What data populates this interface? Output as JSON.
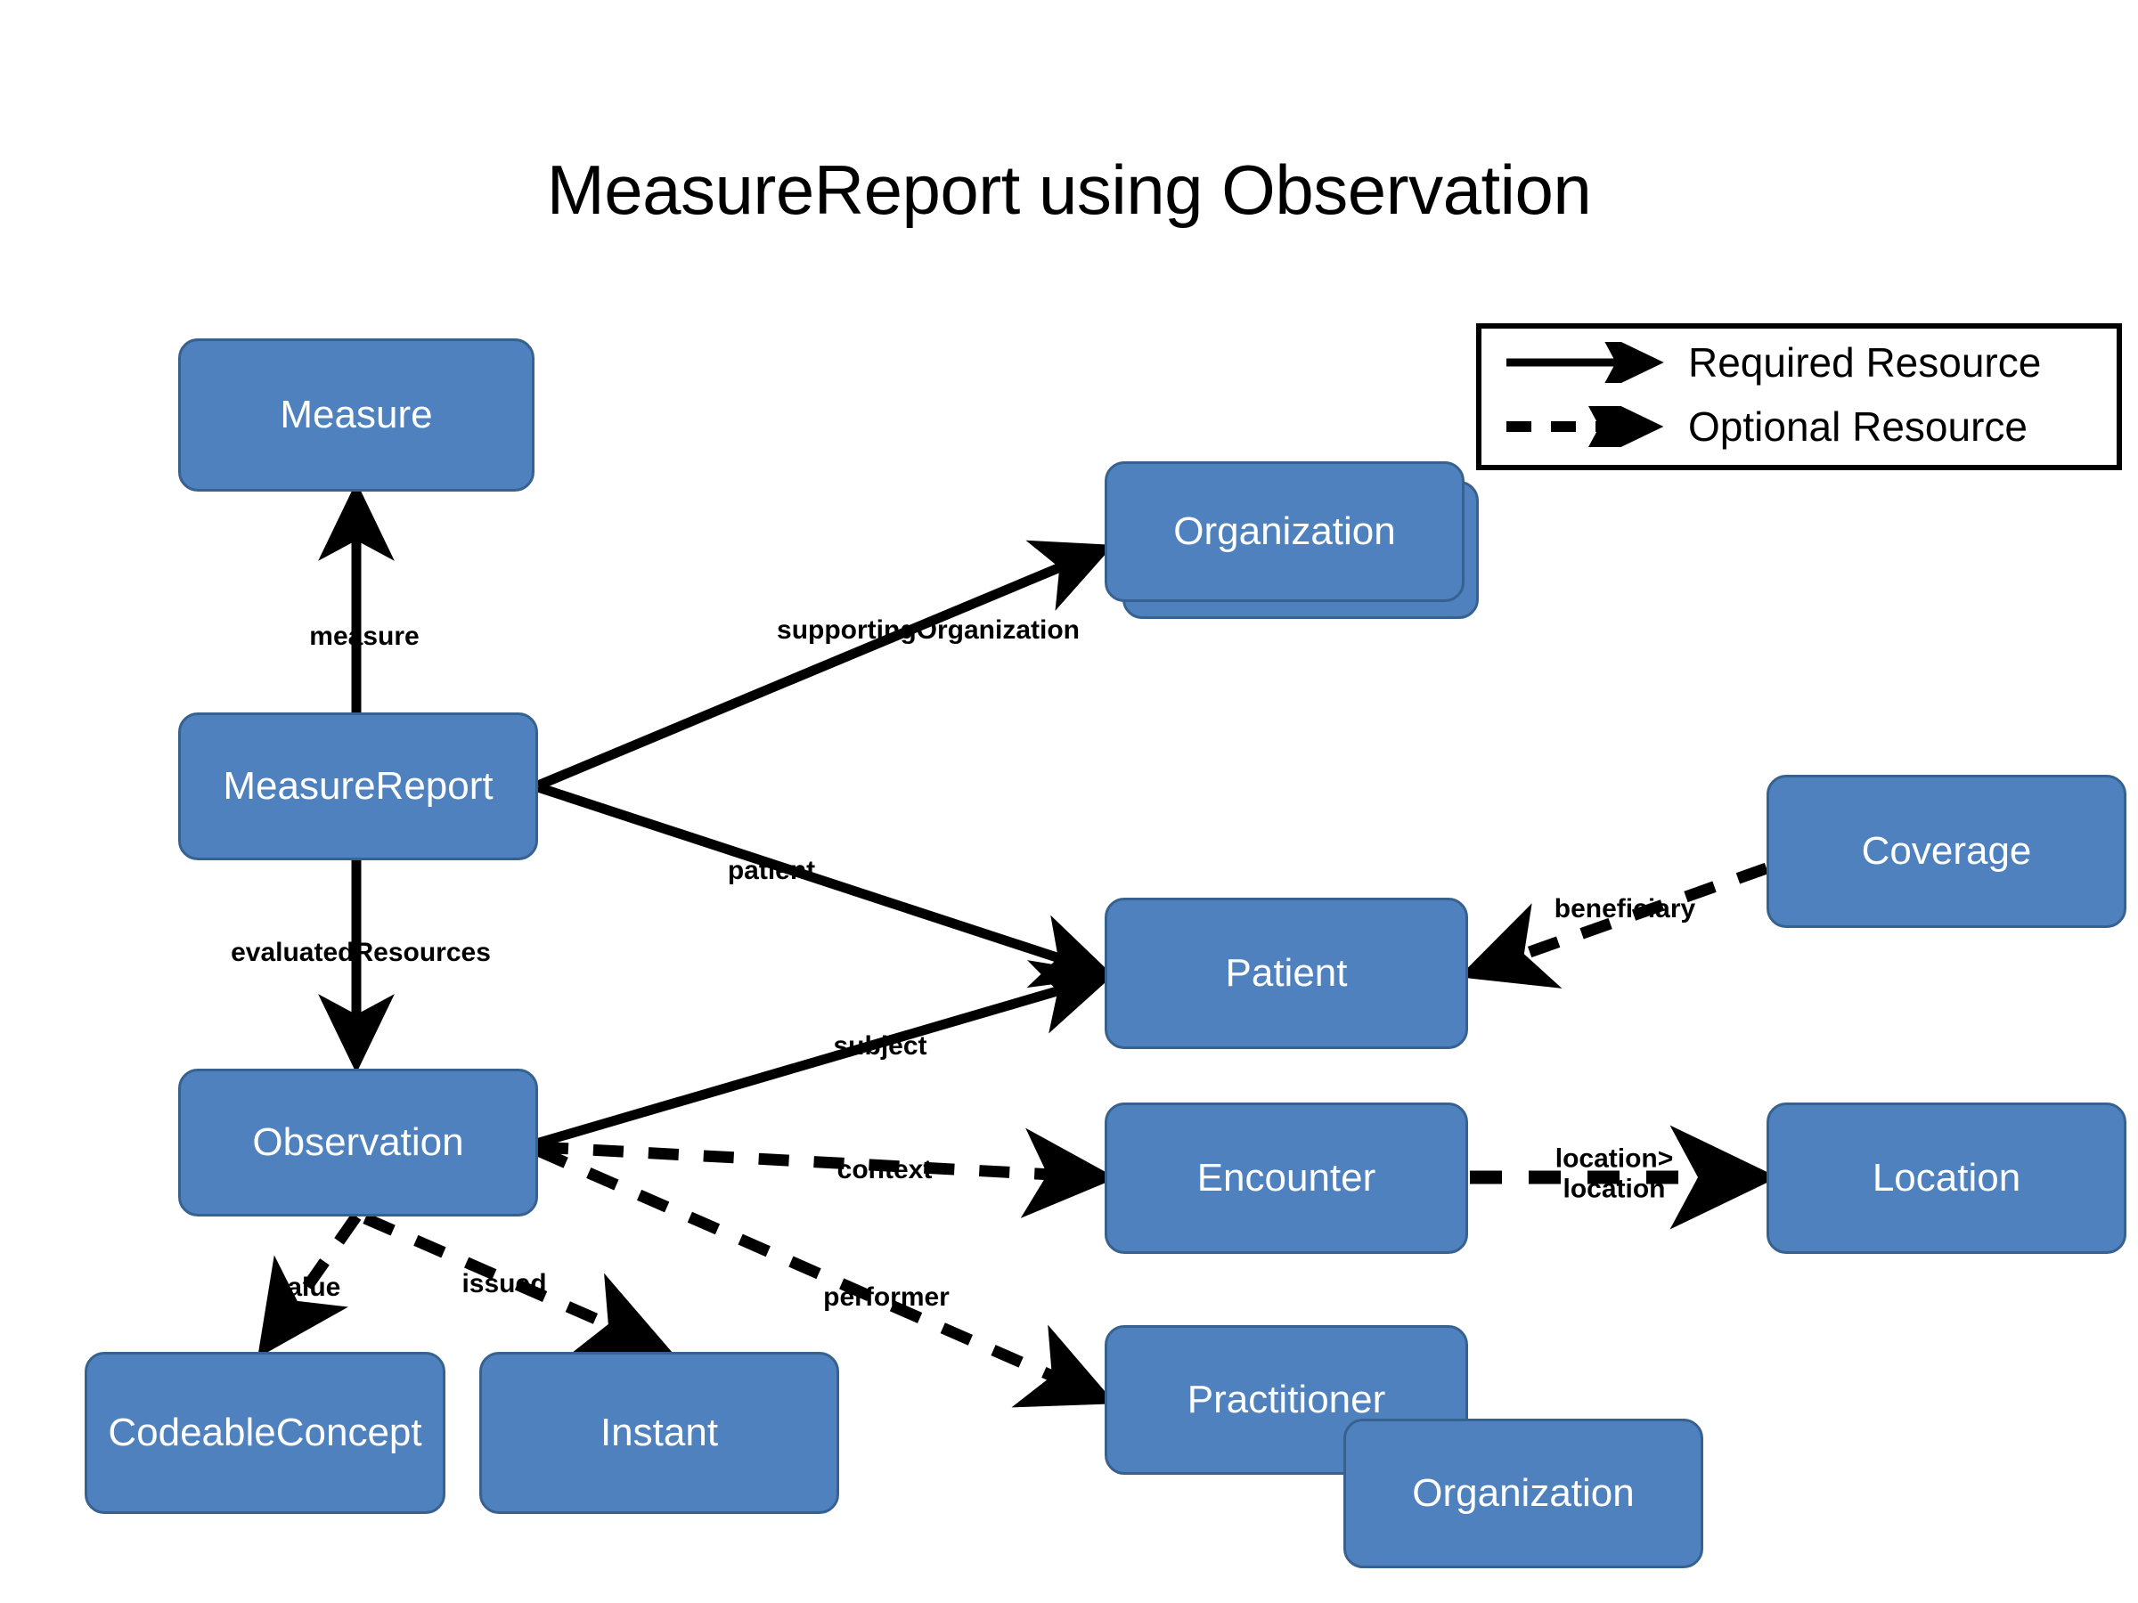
{
  "title": "MeasureReport using Observation",
  "colors": {
    "node_fill": "#4E81BD",
    "node_border": "#37618E",
    "node_text": "#FFFFFF",
    "edge": "#000000",
    "background": "#FFFFFF"
  },
  "legend": {
    "items": [
      {
        "label": "Required Resource",
        "style": "solid",
        "icon": "arrow-right-icon"
      },
      {
        "label": "Optional Resource",
        "style": "dashed",
        "icon": "arrow-right-dashed-icon"
      }
    ]
  },
  "nodes": [
    {
      "id": "measure",
      "label": "Measure"
    },
    {
      "id": "measurereport",
      "label": "MeasureReport"
    },
    {
      "id": "observation",
      "label": "Observation"
    },
    {
      "id": "codeableconcept",
      "label": "CodeableConcept"
    },
    {
      "id": "instant",
      "label": "Instant"
    },
    {
      "id": "organization-back",
      "label": ""
    },
    {
      "id": "organization-top",
      "label": "Organization"
    },
    {
      "id": "coverage",
      "label": "Coverage"
    },
    {
      "id": "patient",
      "label": "Patient"
    },
    {
      "id": "encounter",
      "label": "Encounter"
    },
    {
      "id": "location",
      "label": "Location"
    },
    {
      "id": "practitioner",
      "label": "Practitioner"
    },
    {
      "id": "organization-bottom",
      "label": "Organization"
    }
  ],
  "edges": [
    {
      "id": "measure",
      "label": "measure",
      "from": "measurereport",
      "to": "measure",
      "style": "solid"
    },
    {
      "id": "evaluatedresources",
      "label": "evaluatedResources",
      "from": "measurereport",
      "to": "observation",
      "style": "solid"
    },
    {
      "id": "supportingorganization",
      "label": "supportingOrganization",
      "from": "measurereport",
      "to": "organization-top",
      "style": "solid"
    },
    {
      "id": "patient",
      "label": "patient",
      "from": "measurereport",
      "to": "patient",
      "style": "solid"
    },
    {
      "id": "subject",
      "label": "subject",
      "from": "observation",
      "to": "patient",
      "style": "solid"
    },
    {
      "id": "context",
      "label": "context",
      "from": "observation",
      "to": "encounter",
      "style": "dashed"
    },
    {
      "id": "performer",
      "label": "performer",
      "from": "observation",
      "to": "practitioner",
      "style": "dashed"
    },
    {
      "id": "value",
      "label": "value",
      "from": "observation",
      "to": "codeableconcept",
      "style": "dashed"
    },
    {
      "id": "issued",
      "label": "issued",
      "from": "observation",
      "to": "instant",
      "style": "dashed"
    },
    {
      "id": "beneficiary",
      "label": "beneficiary",
      "from": "coverage",
      "to": "patient",
      "style": "dashed"
    },
    {
      "id": "location",
      "label": "location>\nlocation",
      "from": "encounter",
      "to": "location",
      "style": "dashed"
    }
  ]
}
